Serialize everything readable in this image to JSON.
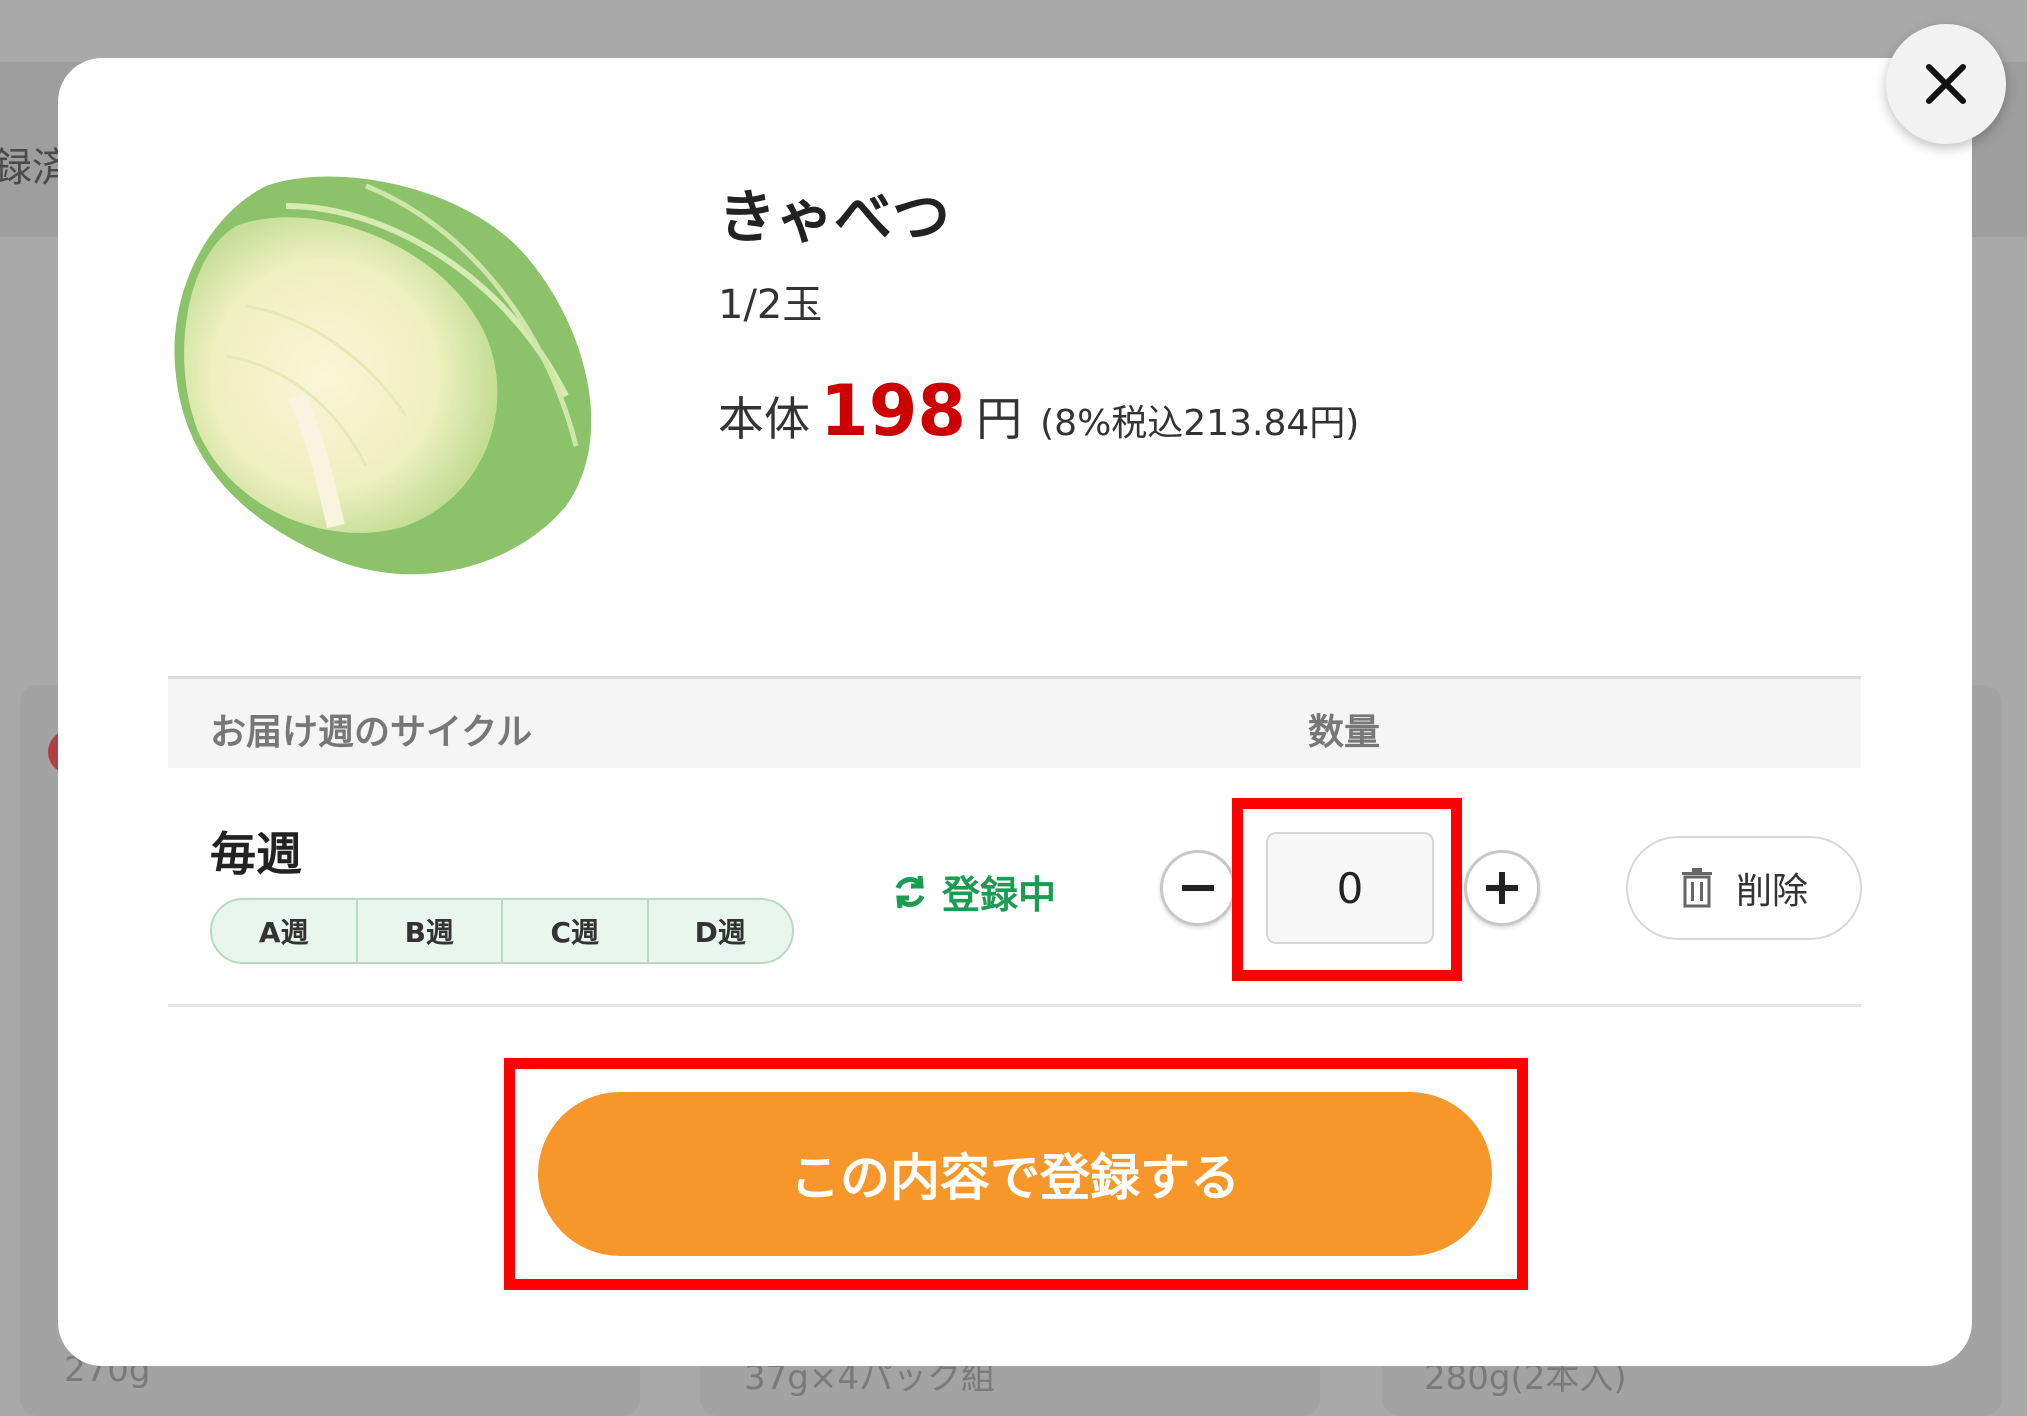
{
  "background": {
    "header_text": "録済",
    "card_labels": [
      "270g",
      "37g×4パック組",
      "280g(2本入)"
    ]
  },
  "modal": {
    "product": {
      "name": "きゃべつ",
      "size": "1/2玉",
      "price_label": "本体",
      "price_value": "198",
      "price_unit": "円",
      "price_tax": "(8%税込213.84円)",
      "image_icon": "cabbage-image"
    },
    "table": {
      "header_cycle": "お届け週のサイクル",
      "header_quantity": "数量"
    },
    "row": {
      "cycle": "毎週",
      "weeks": [
        "A週",
        "B週",
        "C週",
        "D週"
      ],
      "status": "登録中",
      "status_icon": "refresh-icon",
      "quantity": "0",
      "delete_label": "削除",
      "delete_icon": "trash-icon"
    },
    "submit_label": "この内容で登録する",
    "colors": {
      "price": "#cc0000",
      "status": "#1a9c52",
      "submit": "#f7972a",
      "highlight": "#ff0000"
    }
  }
}
